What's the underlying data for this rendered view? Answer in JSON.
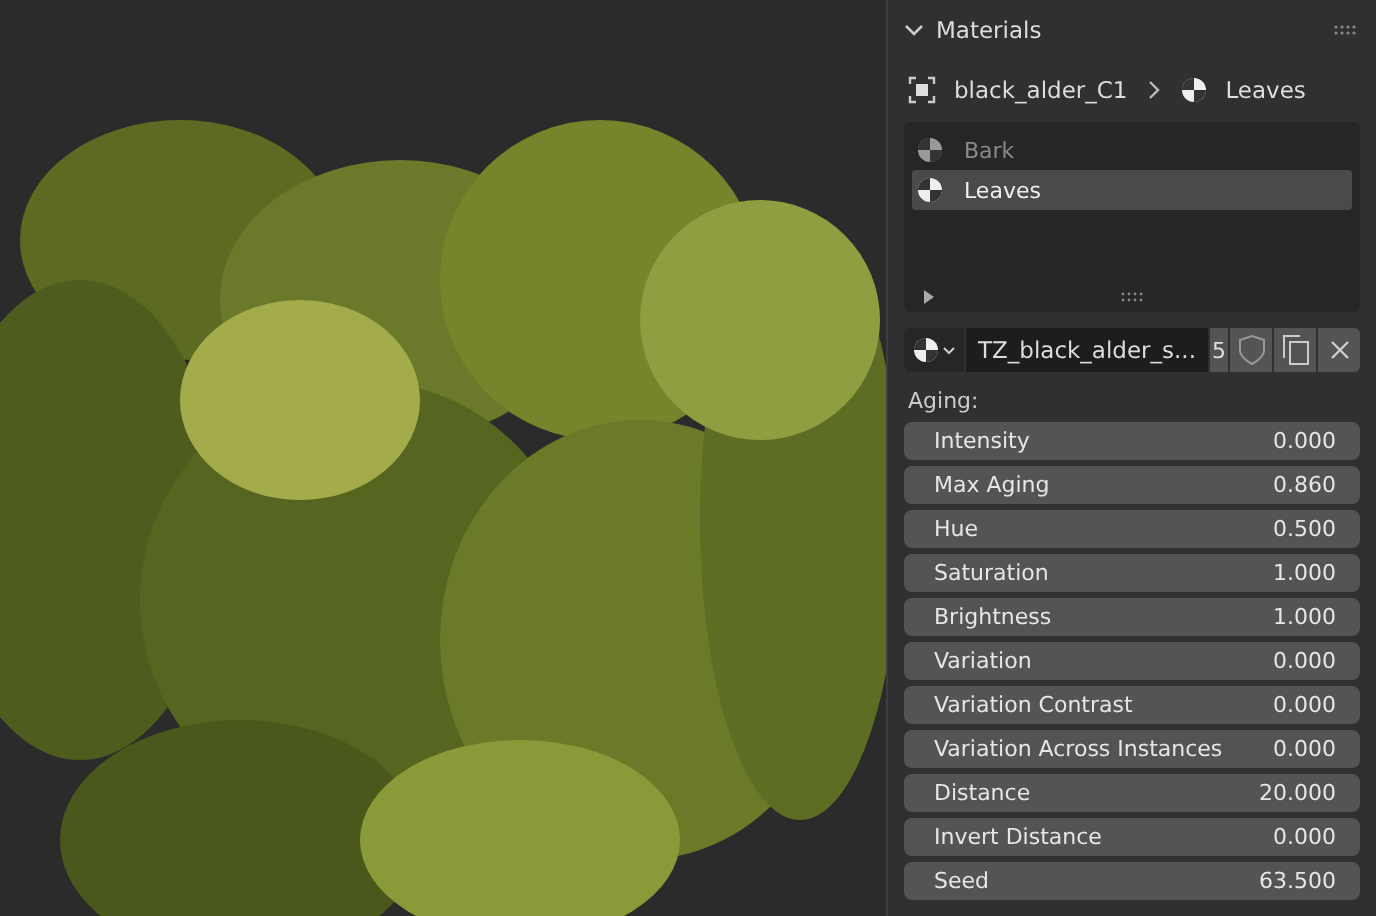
{
  "panel": {
    "title": "Materials",
    "expanded": true
  },
  "breadcrumb": {
    "object": "black_alder_C1",
    "material": "Leaves"
  },
  "slots": [
    {
      "name": "Bark",
      "selected": false
    },
    {
      "name": "Leaves",
      "selected": true
    }
  ],
  "material": {
    "name": "TZ_black_alder_s...",
    "users": "5"
  },
  "section": "Aging:",
  "fields": [
    {
      "label": "Intensity",
      "value": "0.000"
    },
    {
      "label": "Max Aging",
      "value": "0.860"
    },
    {
      "label": "Hue",
      "value": "0.500"
    },
    {
      "label": "Saturation",
      "value": "1.000"
    },
    {
      "label": "Brightness",
      "value": "1.000"
    },
    {
      "label": "Variation",
      "value": "0.000"
    },
    {
      "label": "Variation Contrast",
      "value": "0.000"
    },
    {
      "label": "Variation Across Instances",
      "value": "0.000"
    },
    {
      "label": "Distance",
      "value": "20.000"
    },
    {
      "label": "Invert Distance",
      "value": "0.000"
    },
    {
      "label": "Seed",
      "value": "63.500"
    }
  ]
}
